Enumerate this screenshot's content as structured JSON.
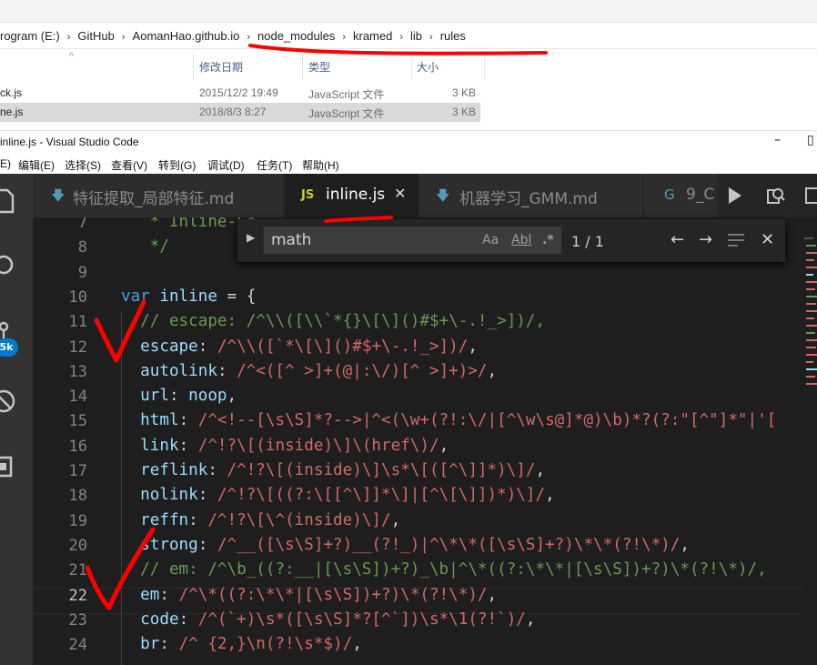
{
  "explorer": {
    "breadcrumbs": [
      "rogram (E:)",
      "GitHub",
      "AomanHao.github.io",
      "node_modules",
      "kramed",
      "lib",
      "rules"
    ],
    "columns": {
      "date": "修改日期",
      "type": "类型",
      "size": "大小"
    },
    "files": [
      {
        "name": "ck.js",
        "date": "2015/12/2 19:49",
        "type": "JavaScript 文件",
        "size": "3 KB",
        "selected": false
      },
      {
        "name": "ne.js",
        "date": "2018/8/3 8:27",
        "type": "JavaScript 文件",
        "size": "3 KB",
        "selected": true
      }
    ]
  },
  "vscode": {
    "window_title": "inline.js - Visual Studio Code",
    "menu": [
      "E)",
      "编辑(E)",
      "选择(S)",
      "查看(V)",
      "转到(G)",
      "调试(D)",
      "任务(T)",
      "帮助(H)"
    ],
    "activity_badge": "5k",
    "tabs": [
      {
        "label": "特征提取_局部特征.md",
        "icon": "markdown-icon",
        "active": false
      },
      {
        "label": "inline.js",
        "icon_text": "JS",
        "active": true
      },
      {
        "label": "机器学习_GMM.md",
        "icon": "markdown-icon",
        "active": false
      },
      {
        "label": "9_C",
        "icon": "csharp-icon",
        "active": false
      }
    ],
    "find": {
      "value": "math",
      "opt_case": "Aa",
      "opt_word": "Abl",
      "opt_regex": ".*",
      "count": "1 / 1"
    },
    "current_line": "22",
    "colors": {
      "keyword": "#569cd6",
      "comment": "#6a9955",
      "property": "#9cdcfe",
      "regex": "#d16969",
      "annotation": "#ff0000"
    }
  },
  "code_lines": [
    {
      "n": "7",
      "parts": [
        {
          "t": "   * Inline-Le",
          "c": "c-comment"
        }
      ]
    },
    {
      "n": "8",
      "parts": [
        {
          "t": "   */",
          "c": "c-comment"
        }
      ]
    },
    {
      "n": "9",
      "parts": []
    },
    {
      "n": "10",
      "parts": [
        {
          "t": "var",
          "c": "c-kw"
        },
        {
          "t": " ",
          "c": "c-punc"
        },
        {
          "t": "inline",
          "c": "c-var"
        },
        {
          "t": " = {",
          "c": "c-punc"
        }
      ]
    },
    {
      "n": "11",
      "parts": [
        {
          "t": "  // escape: /^\\\\([\\\\`*{}\\[\\]()#$+\\-.!_>])/,",
          "c": "c-comment"
        }
      ]
    },
    {
      "n": "12",
      "parts": [
        {
          "t": "  escape",
          "c": "c-key"
        },
        {
          "t": ": ",
          "c": "c-punc"
        },
        {
          "t": "/^\\\\([`*\\[\\]()#$+\\-.!_>])/",
          "c": "c-regex"
        },
        {
          "t": ",",
          "c": "c-punc"
        }
      ]
    },
    {
      "n": "13",
      "parts": [
        {
          "t": "  autolink",
          "c": "c-key"
        },
        {
          "t": ": ",
          "c": "c-punc"
        },
        {
          "t": "/^<([^ >]+(@|:\\/)[^ >]+)>/",
          "c": "c-regex"
        },
        {
          "t": ",",
          "c": "c-punc"
        }
      ]
    },
    {
      "n": "14",
      "parts": [
        {
          "t": "  url",
          "c": "c-key"
        },
        {
          "t": ": ",
          "c": "c-punc"
        },
        {
          "t": "noop",
          "c": "c-var"
        },
        {
          "t": ",",
          "c": "c-punc"
        }
      ]
    },
    {
      "n": "15",
      "parts": [
        {
          "t": "  html",
          "c": "c-key"
        },
        {
          "t": ": ",
          "c": "c-punc"
        },
        {
          "t": "/^<!--[\\s\\S]*?-->|^<(\\w+(?!:\\/|[^\\w\\s@]*@)\\b)*?(?:\"[^\"]*\"|'[",
          "c": "c-regex"
        }
      ]
    },
    {
      "n": "16",
      "parts": [
        {
          "t": "  link",
          "c": "c-key"
        },
        {
          "t": ": ",
          "c": "c-punc"
        },
        {
          "t": "/^!?\\[(inside)\\]\\(href\\)/",
          "c": "c-regex"
        },
        {
          "t": ",",
          "c": "c-punc"
        }
      ]
    },
    {
      "n": "17",
      "parts": [
        {
          "t": "  reflink",
          "c": "c-key"
        },
        {
          "t": ": ",
          "c": "c-punc"
        },
        {
          "t": "/^!?\\[(inside)\\]\\s*\\[([^\\]]*)\\]/",
          "c": "c-regex"
        },
        {
          "t": ",",
          "c": "c-punc"
        }
      ]
    },
    {
      "n": "18",
      "parts": [
        {
          "t": "  nolink",
          "c": "c-key"
        },
        {
          "t": ": ",
          "c": "c-punc"
        },
        {
          "t": "/^!?\\[((?:\\[[^\\]]*\\]|[^\\[\\]])*)\\]/",
          "c": "c-regex"
        },
        {
          "t": ",",
          "c": "c-punc"
        }
      ]
    },
    {
      "n": "19",
      "parts": [
        {
          "t": "  reffn",
          "c": "c-key"
        },
        {
          "t": ": ",
          "c": "c-punc"
        },
        {
          "t": "/^!?\\[\\^(inside)\\]/",
          "c": "c-regex"
        },
        {
          "t": ",",
          "c": "c-punc"
        }
      ]
    },
    {
      "n": "20",
      "parts": [
        {
          "t": "  strong",
          "c": "c-key"
        },
        {
          "t": ": ",
          "c": "c-punc"
        },
        {
          "t": "/^__([\\s\\S]+?)__(?!_)|^\\*\\*([\\s\\S]+?)\\*\\*(?!\\*)/",
          "c": "c-regex"
        },
        {
          "t": ",",
          "c": "c-punc"
        }
      ]
    },
    {
      "n": "21",
      "parts": [
        {
          "t": "  // em: /^\\b_((?:__|[\\s\\S])+?)_\\b|^\\*((?:\\*\\*|[\\s\\S])+?)\\*(?!\\*)/,",
          "c": "c-comment"
        }
      ]
    },
    {
      "n": "22",
      "parts": [
        {
          "t": "  em",
          "c": "c-key"
        },
        {
          "t": ": ",
          "c": "c-punc"
        },
        {
          "t": "/^\\*((?:\\*\\*|[\\s\\S])+?)\\*(?!\\*)/",
          "c": "c-regex"
        },
        {
          "t": ",",
          "c": "c-punc"
        }
      ]
    },
    {
      "n": "23",
      "parts": [
        {
          "t": "  code",
          "c": "c-key"
        },
        {
          "t": ": ",
          "c": "c-punc"
        },
        {
          "t": "/^(`+)\\s*([\\s\\S]*?[^`])\\s*\\1(?!`)/",
          "c": "c-regex"
        },
        {
          "t": ",",
          "c": "c-punc"
        }
      ]
    },
    {
      "n": "24",
      "parts": [
        {
          "t": "  br",
          "c": "c-key"
        },
        {
          "t": ": ",
          "c": "c-punc"
        },
        {
          "t": "/^ {2,}\\n(?!\\s*$)/",
          "c": "c-regex"
        },
        {
          "t": ",",
          "c": "c-punc"
        }
      ]
    }
  ]
}
